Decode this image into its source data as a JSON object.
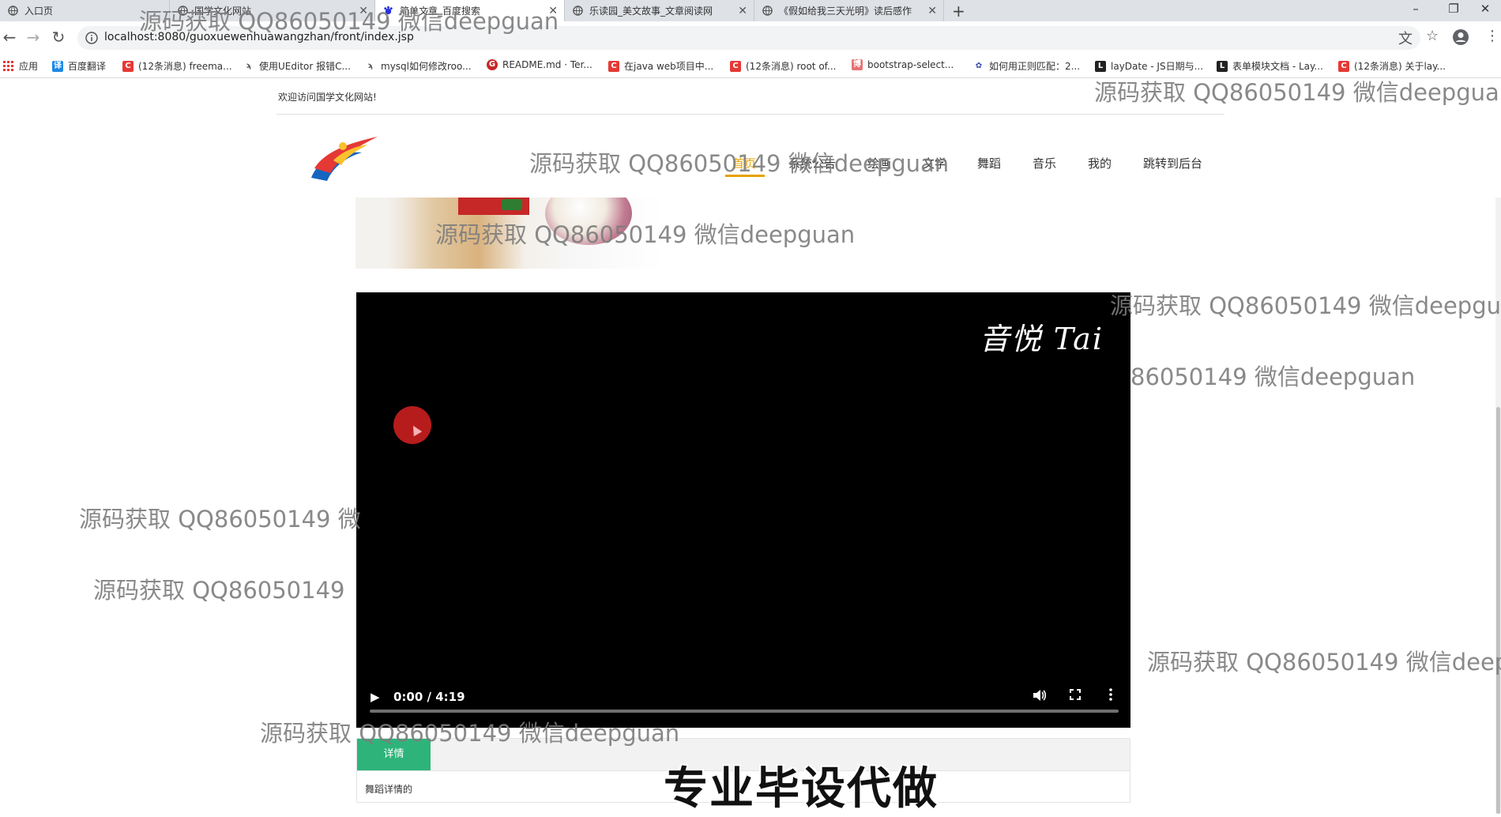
{
  "browser": {
    "tabs": [
      {
        "title": "入口页",
        "active": false,
        "icon": "globe-icon"
      },
      {
        "title": "国学文化网站",
        "active": false,
        "icon": "globe-icon"
      },
      {
        "title": "简单文章_百度搜索",
        "active": true,
        "icon": "baidu-icon"
      },
      {
        "title": "乐读园_美文故事_文章阅读网",
        "active": false,
        "icon": "globe-icon"
      },
      {
        "title": "《假如给我三天光明》读后感作",
        "active": false,
        "icon": "globe-icon"
      }
    ],
    "new_tab_label": "+",
    "window_controls": {
      "minimize": "–",
      "restore": "❐",
      "close": "✕"
    },
    "url": "localhost:8080/guoxuewenhuawangzhan/front/index.jsp",
    "bookmarks": [
      {
        "label": "应用",
        "icon": "apps-icon",
        "color": "#e53935"
      },
      {
        "label": "百度翻译",
        "icon": "translate-icon",
        "color": "#1e88e5"
      },
      {
        "label": "(12条消息) freema...",
        "icon": "csdn-icon",
        "color": "#e53935"
      },
      {
        "label": "使用UEditor 报错C...",
        "icon": "hook-icon",
        "color": "#555555"
      },
      {
        "label": "mysql如何修改roo...",
        "icon": "hook-icon",
        "color": "#555555"
      },
      {
        "label": "README.md · Ter...",
        "icon": "gitee-icon",
        "color": "#c62828"
      },
      {
        "label": "在java web项目中...",
        "icon": "csdn-icon",
        "color": "#e53935"
      },
      {
        "label": "(12条消息) root of...",
        "icon": "csdn-icon",
        "color": "#e53935"
      },
      {
        "label": "bootstrap-select...",
        "icon": "blog-icon",
        "color": "#e57373"
      },
      {
        "label": "如何用正则匹配：2...",
        "icon": "paw-icon",
        "color": "#3949ab"
      },
      {
        "label": "layDate - JS日期与...",
        "icon": "layui-icon",
        "color": "#222222"
      },
      {
        "label": "表单模块文档 - Lay...",
        "icon": "layui-icon",
        "color": "#222222"
      },
      {
        "label": "(12条消息) 关于lay...",
        "icon": "csdn-icon",
        "color": "#e53935"
      }
    ]
  },
  "site": {
    "welcome": "欢迎访问国学文化网站!",
    "nav": [
      {
        "label": "首页",
        "active": true
      },
      {
        "label": "系统公告",
        "active": false
      },
      {
        "label": "绘画",
        "active": false
      },
      {
        "label": "文学",
        "active": false
      },
      {
        "label": "舞蹈",
        "active": false
      },
      {
        "label": "音乐",
        "active": false
      },
      {
        "label": "我的",
        "active": false
      },
      {
        "label": "跳转到后台",
        "active": false
      }
    ],
    "accent_color": "#e5a200"
  },
  "video": {
    "watermark": "音悦 Tai",
    "time": "0:00 / 4:19",
    "progress": 0
  },
  "detail": {
    "tab_label": "详情",
    "text": "舞蹈详情的",
    "tab_color": "#2eb47a"
  },
  "overlay": {
    "watermarks": [
      "源码获取 QQ86050149 微信deepguan",
      "源码获取 QQ86050149 微信deepgua",
      "源码获取 QQ86050149 微信deepguan",
      "源码获取 QQ86050149 微信deepguan",
      "源码获取 QQ86050149 微信deepgu",
      "86050149 微信deepguan",
      "源码获取 QQ86050149 微",
      "源码获取 QQ86050149",
      "源码获取 QQ86050149 微信deep",
      "源码获取 QQ86050149 微信deepguan"
    ],
    "stamp": "专业毕设代做"
  }
}
